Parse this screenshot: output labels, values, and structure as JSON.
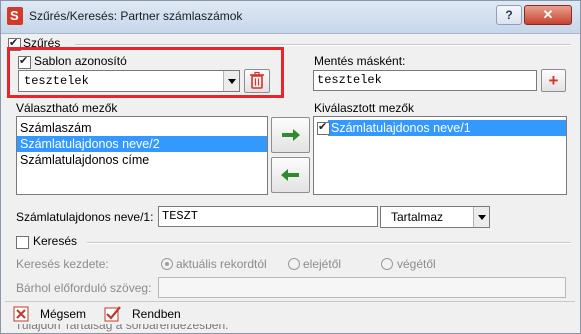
{
  "window": {
    "title": "Szűrés/Keresés: Partner számlaszámok",
    "help_label": "?",
    "close_label": "✕"
  },
  "filter_section": {
    "label": "Szűrés",
    "checked": true
  },
  "template": {
    "checkbox_label": "Sablon azonosító",
    "checked": true,
    "selected_value": "tesztelek"
  },
  "save_as": {
    "label": "Mentés másként:",
    "value": "tesztelek",
    "add_label": "+"
  },
  "available_fields": {
    "label": "Választható mezők",
    "items": [
      "Számlaszám",
      "Számlatulajdonos neve/2",
      "Számlatulajdonos címe"
    ],
    "selected_index": 1
  },
  "selected_fields": {
    "label": "Kiválasztott mezők",
    "items": [
      {
        "label": "Számlatulajdonos neve/1",
        "checked": true
      }
    ]
  },
  "field_condition": {
    "label": "Számlatulajdonos neve/1:",
    "value": "TESZT",
    "operator": "Tartalmaz"
  },
  "search_section": {
    "label": "Keresés",
    "checked": false,
    "start_label": "Keresés kezdete:",
    "options": [
      "aktuális rekordtól",
      "elejétől",
      "végétől"
    ],
    "selected_option": 0,
    "anywhere_label": "Bárhol előforduló szöveg:",
    "anywhere_value": ""
  },
  "footer": {
    "cancel_label": "Mégsem",
    "ok_label": "Rendben",
    "background_text": "Tulajdon  Tartaiság a sorbarendezésben:"
  },
  "colors": {
    "highlight_frame": "#e8252b",
    "selection": "#3399ff",
    "arrow_green": "#2e8b2e"
  }
}
